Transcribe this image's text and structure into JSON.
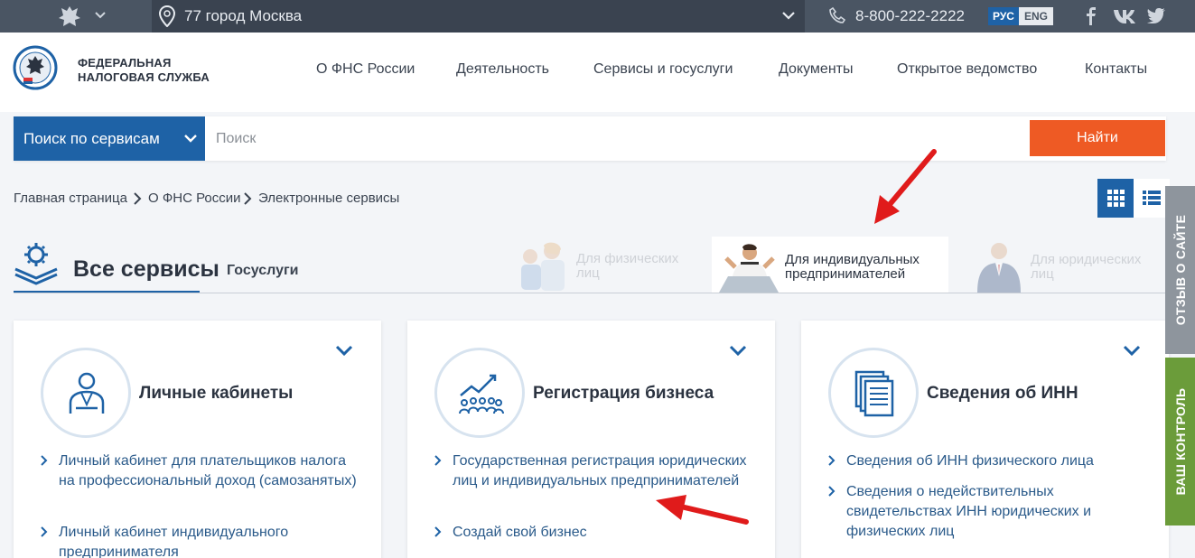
{
  "topbar": {
    "region": "77 город Москва",
    "phone": "8-800-222-2222",
    "lang_ru": "РУС",
    "lang_en": "ENG",
    "social": [
      "f",
      "vk",
      "twitter"
    ]
  },
  "header": {
    "logo_line1": "ФЕДЕРАЛЬНАЯ",
    "logo_line2": "НАЛОГОВАЯ СЛУЖБА",
    "nav": [
      "О ФНС России",
      "Деятельность",
      "Сервисы и госуслуги",
      "Документы",
      "Открытое ведомство",
      "Контакты"
    ]
  },
  "search": {
    "select_label": "Поиск по сервисам",
    "placeholder": "Поиск",
    "button": "Найти"
  },
  "breadcrumb": [
    "Главная страница",
    "О ФНС России",
    "Электронные сервисы"
  ],
  "tabs": {
    "all": "Все сервисы",
    "gos": "Госуслуги",
    "audience": [
      {
        "line1": "Для физических",
        "line2": "лиц"
      },
      {
        "line1": "Для индивидуальных",
        "line2": "предпринимателей"
      },
      {
        "line1": "Для юридических",
        "line2": "лиц"
      }
    ]
  },
  "cards": [
    {
      "title": "Личные кабинеты",
      "icon": "person-icon",
      "links": [
        "Личный кабинет для плательщиков налога на профессиональный доход (самозанятых)",
        "Личный кабинет индивидуального предпринимателя"
      ]
    },
    {
      "title": "Регистрация бизнеса",
      "icon": "business-growth-icon",
      "links": [
        "Государственная регистрация юридических лиц и индивидуальных предпринимателей",
        "Создай свой бизнес"
      ]
    },
    {
      "title": "Сведения об ИНН",
      "icon": "documents-icon",
      "links": [
        "Сведения об ИНН физического лица",
        "Сведения о недействительных свидетельствах ИНН юридических и физических лиц"
      ]
    }
  ],
  "side": {
    "feedback": "ОТЗЫВ О САЙТЕ",
    "control": "ВАШ КОНТРОЛЬ"
  },
  "colors": {
    "brand_blue": "#1e62a6",
    "accent_orange": "#ee5a24",
    "topbar": "#4a5563",
    "side_green": "#6b9c3a"
  }
}
